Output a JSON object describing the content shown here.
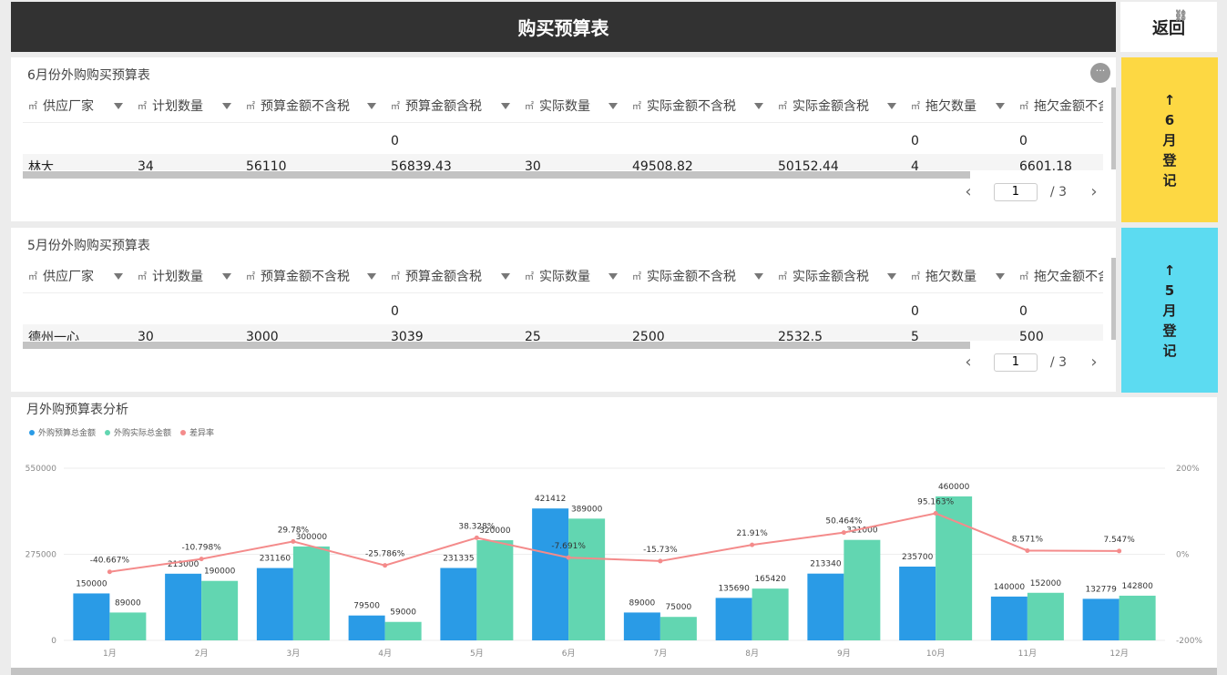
{
  "header": {
    "title": "购买预算表",
    "back_label": "返回"
  },
  "columns": [
    "供应厂家",
    "计划数量",
    "预算金额不含税",
    "预算金额含税",
    "实际数量",
    "实际金额不含税",
    "实际金额含税",
    "拖欠数量",
    "拖欠金额不含税"
  ],
  "june": {
    "title": "6月份外购购买预算表",
    "row1": [
      "",
      "",
      "",
      "0",
      "",
      "",
      "",
      "0",
      "0"
    ],
    "row2": [
      "林大",
      "34",
      "56110",
      "56839.43",
      "30",
      "49508.82",
      "50152.44",
      "4",
      "6601.18"
    ],
    "page": "1",
    "total_pages": "/ 3",
    "side_label": [
      "↑",
      "6",
      "月",
      "登",
      "记"
    ]
  },
  "may": {
    "title": "5月份外购购买预算表",
    "row1": [
      "",
      "",
      "",
      "0",
      "",
      "",
      "",
      "0",
      "0"
    ],
    "row2": [
      "德州一心",
      "30",
      "3000",
      "3039",
      "25",
      "2500",
      "2532.5",
      "5",
      "500"
    ],
    "page": "1",
    "total_pages": "/ 3",
    "side_label": [
      "↑",
      "5",
      "月",
      "登",
      "记"
    ]
  },
  "colors": {
    "june_side": "#fdd843",
    "may_side": "#5cdbf1",
    "budget": "#2a9be6",
    "actual": "#62d6b1",
    "rate": "#f48b8b"
  },
  "chart_data": {
    "type": "bar",
    "title": "月外购预算表分析",
    "categories": [
      "1月",
      "2月",
      "3月",
      "4月",
      "5月",
      "6月",
      "7月",
      "8月",
      "9月",
      "10月",
      "11月",
      "12月"
    ],
    "series": [
      {
        "name": "外购预算总金额",
        "values": [
          150000,
          213000,
          231160,
          79500,
          231335,
          421412,
          89000,
          135690,
          213340,
          235700,
          140000,
          132779
        ]
      },
      {
        "name": "外购实际总金额",
        "values": [
          89000,
          190000,
          300000,
          59000,
          320000,
          389000,
          75000,
          165420,
          321000,
          460000,
          152000,
          142800
        ]
      },
      {
        "name": "差异率",
        "type": "line",
        "values": [
          -40.667,
          -10.798,
          29.78,
          -25.786,
          38.328,
          -7.691,
          -15.73,
          21.91,
          50.464,
          95.163,
          8.571,
          7.547
        ],
        "labels": [
          "-40.667%",
          "-10.798%",
          "29.78%",
          "-25.786%",
          "38.328%",
          "-7.691%",
          "-15.73%",
          "21.91%",
          "50.464%",
          "95.163%",
          "8.571%",
          "7.547%"
        ]
      }
    ],
    "ylim": [
      0,
      550000
    ],
    "y_ticks": [
      "0",
      "275000",
      "550000"
    ],
    "y2lim": [
      -200,
      200
    ],
    "y2_ticks": [
      "-200%",
      "0%",
      "200%"
    ],
    "grid": true,
    "legend": "top-left"
  }
}
